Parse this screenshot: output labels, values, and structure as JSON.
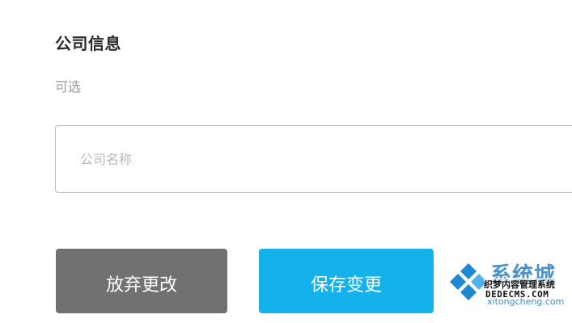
{
  "section": {
    "title": "公司信息",
    "subtitle": "可选"
  },
  "company_name_field": {
    "placeholder": "公司名称",
    "value": ""
  },
  "actions": {
    "discard_label": "放弃更改",
    "save_label": "保存变更"
  },
  "watermark": {
    "brand_text": "系统城",
    "line1": "织梦内容管理系统",
    "line2": "DEDECMS.COM",
    "line3": "xitongcheng.com"
  },
  "colors": {
    "discard_button": "#717171",
    "save_button": "#14b2ec",
    "title_text": "#2b2b2b",
    "subtitle_text": "#9a9a9a",
    "input_border": "#bdbdbd",
    "placeholder_text": "#b8b8b8"
  }
}
